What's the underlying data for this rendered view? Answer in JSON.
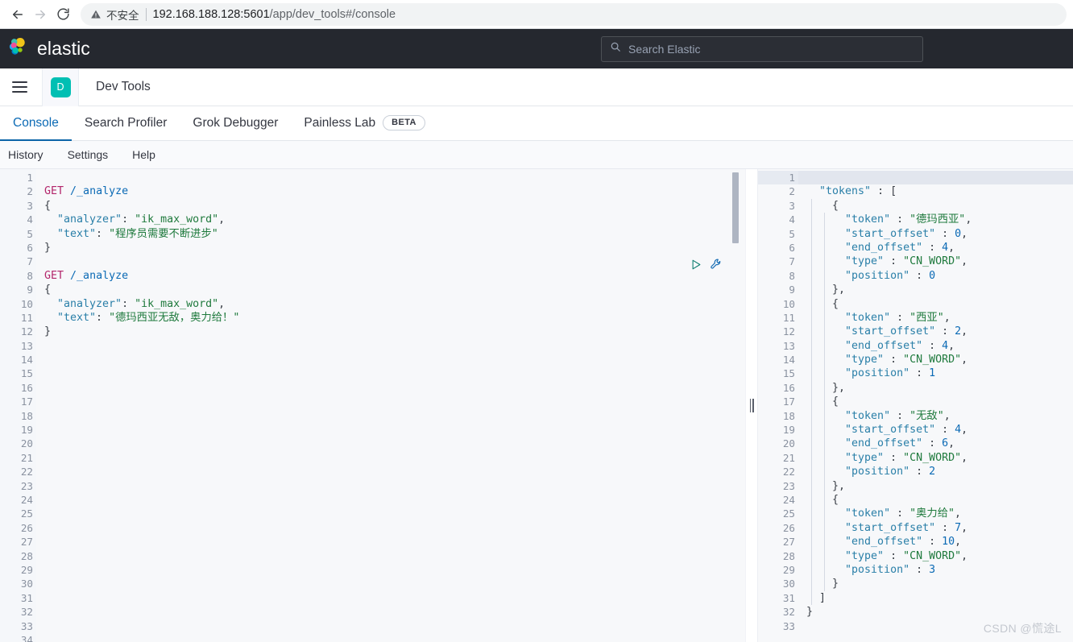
{
  "browser": {
    "back_icon": "arrow-left-icon",
    "forward_icon": "arrow-right-icon",
    "reload_icon": "reload-icon",
    "security_icon": "warning-triangle-icon",
    "security_label": "不安全",
    "url_host": "192.168.188.128:5601",
    "url_path": "/app/dev_tools#/console"
  },
  "elastic_header": {
    "logo_icon": "elastic-logo-icon",
    "brand": "elastic",
    "search": {
      "icon": "search-icon",
      "placeholder": "Search Elastic",
      "value": ""
    }
  },
  "app_header": {
    "menu_icon": "hamburger-menu-icon",
    "app_badge": "D",
    "app_badge_color": "#00bfb3",
    "title": "Dev Tools"
  },
  "tabs": [
    {
      "label": "Console",
      "active": true,
      "badge": null
    },
    {
      "label": "Search Profiler",
      "active": false,
      "badge": null
    },
    {
      "label": "Grok Debugger",
      "active": false,
      "badge": null
    },
    {
      "label": "Painless Lab",
      "active": false,
      "badge": "BETA"
    }
  ],
  "submenu": [
    {
      "label": "History"
    },
    {
      "label": "Settings"
    },
    {
      "label": "Help"
    }
  ],
  "editor": {
    "run_icon": "play-triangle-icon",
    "wrench_icon": "wrench-icon",
    "scrollbar": "vertical-scrollbar",
    "first_line": 1,
    "last_line": 34,
    "fold_open_lines": [
      3,
      9
    ],
    "fold_close_lines": [
      6,
      12
    ],
    "lines": [
      {
        "n": 1,
        "tokens": []
      },
      {
        "n": 2,
        "tokens": [
          {
            "t": "method",
            "v": "GET"
          },
          {
            "t": "punc",
            "v": " "
          },
          {
            "t": "url",
            "v": "/_analyze"
          }
        ]
      },
      {
        "n": 3,
        "tokens": [
          {
            "t": "punc",
            "v": "{"
          }
        ]
      },
      {
        "n": 4,
        "tokens": [
          {
            "t": "key",
            "v": "  \"analyzer\""
          },
          {
            "t": "punc",
            "v": ": "
          },
          {
            "t": "str",
            "v": "\"ik_max_word\""
          },
          {
            "t": "punc",
            "v": ","
          }
        ]
      },
      {
        "n": 5,
        "tokens": [
          {
            "t": "key",
            "v": "  \"text\""
          },
          {
            "t": "punc",
            "v": ": "
          },
          {
            "t": "str",
            "v": "\"程序员需要不断进步\""
          }
        ]
      },
      {
        "n": 6,
        "tokens": [
          {
            "t": "punc",
            "v": "}"
          }
        ]
      },
      {
        "n": 7,
        "tokens": []
      },
      {
        "n": 8,
        "tokens": [
          {
            "t": "method",
            "v": "GET"
          },
          {
            "t": "punc",
            "v": " "
          },
          {
            "t": "url",
            "v": "/_analyze"
          }
        ]
      },
      {
        "n": 9,
        "tokens": [
          {
            "t": "punc",
            "v": "{"
          }
        ]
      },
      {
        "n": 10,
        "tokens": [
          {
            "t": "key",
            "v": "  \"analyzer\""
          },
          {
            "t": "punc",
            "v": ": "
          },
          {
            "t": "str",
            "v": "\"ik_max_word\""
          },
          {
            "t": "punc",
            "v": ","
          }
        ]
      },
      {
        "n": 11,
        "tokens": [
          {
            "t": "key",
            "v": "  \"text\""
          },
          {
            "t": "punc",
            "v": ": "
          },
          {
            "t": "str",
            "v": "\"德玛西亚无敌，奥力给！\""
          }
        ]
      },
      {
        "n": 12,
        "tokens": [
          {
            "t": "punc",
            "v": "}"
          }
        ]
      }
    ]
  },
  "response": {
    "active_line": 1,
    "first_line": 1,
    "last_line": 33,
    "fold_open_lines": [
      1,
      2,
      3,
      10,
      17,
      24
    ],
    "fold_close_lines": [
      9,
      16,
      23,
      30,
      31,
      32
    ],
    "lines": [
      {
        "n": 1,
        "tokens": [
          {
            "t": "punc",
            "v": "{"
          }
        ]
      },
      {
        "n": 2,
        "tokens": [
          {
            "t": "key",
            "v": "  \"tokens\""
          },
          {
            "t": "punc",
            "v": " : ["
          }
        ]
      },
      {
        "n": 3,
        "tokens": [
          {
            "t": "punc",
            "v": "    {"
          }
        ]
      },
      {
        "n": 4,
        "tokens": [
          {
            "t": "key",
            "v": "      \"token\""
          },
          {
            "t": "punc",
            "v": " : "
          },
          {
            "t": "str",
            "v": "\"德玛西亚\""
          },
          {
            "t": "punc",
            "v": ","
          }
        ]
      },
      {
        "n": 5,
        "tokens": [
          {
            "t": "key",
            "v": "      \"start_offset\""
          },
          {
            "t": "punc",
            "v": " : "
          },
          {
            "t": "num",
            "v": "0"
          },
          {
            "t": "punc",
            "v": ","
          }
        ]
      },
      {
        "n": 6,
        "tokens": [
          {
            "t": "key",
            "v": "      \"end_offset\""
          },
          {
            "t": "punc",
            "v": " : "
          },
          {
            "t": "num",
            "v": "4"
          },
          {
            "t": "punc",
            "v": ","
          }
        ]
      },
      {
        "n": 7,
        "tokens": [
          {
            "t": "key",
            "v": "      \"type\""
          },
          {
            "t": "punc",
            "v": " : "
          },
          {
            "t": "str",
            "v": "\"CN_WORD\""
          },
          {
            "t": "punc",
            "v": ","
          }
        ]
      },
      {
        "n": 8,
        "tokens": [
          {
            "t": "key",
            "v": "      \"position\""
          },
          {
            "t": "punc",
            "v": " : "
          },
          {
            "t": "num",
            "v": "0"
          }
        ]
      },
      {
        "n": 9,
        "tokens": [
          {
            "t": "punc",
            "v": "    },"
          }
        ]
      },
      {
        "n": 10,
        "tokens": [
          {
            "t": "punc",
            "v": "    {"
          }
        ]
      },
      {
        "n": 11,
        "tokens": [
          {
            "t": "key",
            "v": "      \"token\""
          },
          {
            "t": "punc",
            "v": " : "
          },
          {
            "t": "str",
            "v": "\"西亚\""
          },
          {
            "t": "punc",
            "v": ","
          }
        ]
      },
      {
        "n": 12,
        "tokens": [
          {
            "t": "key",
            "v": "      \"start_offset\""
          },
          {
            "t": "punc",
            "v": " : "
          },
          {
            "t": "num",
            "v": "2"
          },
          {
            "t": "punc",
            "v": ","
          }
        ]
      },
      {
        "n": 13,
        "tokens": [
          {
            "t": "key",
            "v": "      \"end_offset\""
          },
          {
            "t": "punc",
            "v": " : "
          },
          {
            "t": "num",
            "v": "4"
          },
          {
            "t": "punc",
            "v": ","
          }
        ]
      },
      {
        "n": 14,
        "tokens": [
          {
            "t": "key",
            "v": "      \"type\""
          },
          {
            "t": "punc",
            "v": " : "
          },
          {
            "t": "str",
            "v": "\"CN_WORD\""
          },
          {
            "t": "punc",
            "v": ","
          }
        ]
      },
      {
        "n": 15,
        "tokens": [
          {
            "t": "key",
            "v": "      \"position\""
          },
          {
            "t": "punc",
            "v": " : "
          },
          {
            "t": "num",
            "v": "1"
          }
        ]
      },
      {
        "n": 16,
        "tokens": [
          {
            "t": "punc",
            "v": "    },"
          }
        ]
      },
      {
        "n": 17,
        "tokens": [
          {
            "t": "punc",
            "v": "    {"
          }
        ]
      },
      {
        "n": 18,
        "tokens": [
          {
            "t": "key",
            "v": "      \"token\""
          },
          {
            "t": "punc",
            "v": " : "
          },
          {
            "t": "str",
            "v": "\"无敌\""
          },
          {
            "t": "punc",
            "v": ","
          }
        ]
      },
      {
        "n": 19,
        "tokens": [
          {
            "t": "key",
            "v": "      \"start_offset\""
          },
          {
            "t": "punc",
            "v": " : "
          },
          {
            "t": "num",
            "v": "4"
          },
          {
            "t": "punc",
            "v": ","
          }
        ]
      },
      {
        "n": 20,
        "tokens": [
          {
            "t": "key",
            "v": "      \"end_offset\""
          },
          {
            "t": "punc",
            "v": " : "
          },
          {
            "t": "num",
            "v": "6"
          },
          {
            "t": "punc",
            "v": ","
          }
        ]
      },
      {
        "n": 21,
        "tokens": [
          {
            "t": "key",
            "v": "      \"type\""
          },
          {
            "t": "punc",
            "v": " : "
          },
          {
            "t": "str",
            "v": "\"CN_WORD\""
          },
          {
            "t": "punc",
            "v": ","
          }
        ]
      },
      {
        "n": 22,
        "tokens": [
          {
            "t": "key",
            "v": "      \"position\""
          },
          {
            "t": "punc",
            "v": " : "
          },
          {
            "t": "num",
            "v": "2"
          }
        ]
      },
      {
        "n": 23,
        "tokens": [
          {
            "t": "punc",
            "v": "    },"
          }
        ]
      },
      {
        "n": 24,
        "tokens": [
          {
            "t": "punc",
            "v": "    {"
          }
        ]
      },
      {
        "n": 25,
        "tokens": [
          {
            "t": "key",
            "v": "      \"token\""
          },
          {
            "t": "punc",
            "v": " : "
          },
          {
            "t": "str",
            "v": "\"奥力给\""
          },
          {
            "t": "punc",
            "v": ","
          }
        ]
      },
      {
        "n": 26,
        "tokens": [
          {
            "t": "key",
            "v": "      \"start_offset\""
          },
          {
            "t": "punc",
            "v": " : "
          },
          {
            "t": "num",
            "v": "7"
          },
          {
            "t": "punc",
            "v": ","
          }
        ]
      },
      {
        "n": 27,
        "tokens": [
          {
            "t": "key",
            "v": "      \"end_offset\""
          },
          {
            "t": "punc",
            "v": " : "
          },
          {
            "t": "num",
            "v": "10"
          },
          {
            "t": "punc",
            "v": ","
          }
        ]
      },
      {
        "n": 28,
        "tokens": [
          {
            "t": "key",
            "v": "      \"type\""
          },
          {
            "t": "punc",
            "v": " : "
          },
          {
            "t": "str",
            "v": "\"CN_WORD\""
          },
          {
            "t": "punc",
            "v": ","
          }
        ]
      },
      {
        "n": 29,
        "tokens": [
          {
            "t": "key",
            "v": "      \"position\""
          },
          {
            "t": "punc",
            "v": " : "
          },
          {
            "t": "num",
            "v": "3"
          }
        ]
      },
      {
        "n": 30,
        "tokens": [
          {
            "t": "punc",
            "v": "    }"
          }
        ]
      },
      {
        "n": 31,
        "tokens": [
          {
            "t": "punc",
            "v": "  ]"
          }
        ]
      },
      {
        "n": 32,
        "tokens": [
          {
            "t": "punc",
            "v": "}"
          }
        ]
      },
      {
        "n": 33,
        "tokens": []
      }
    ]
  },
  "watermark": "CSDN @慌途L"
}
